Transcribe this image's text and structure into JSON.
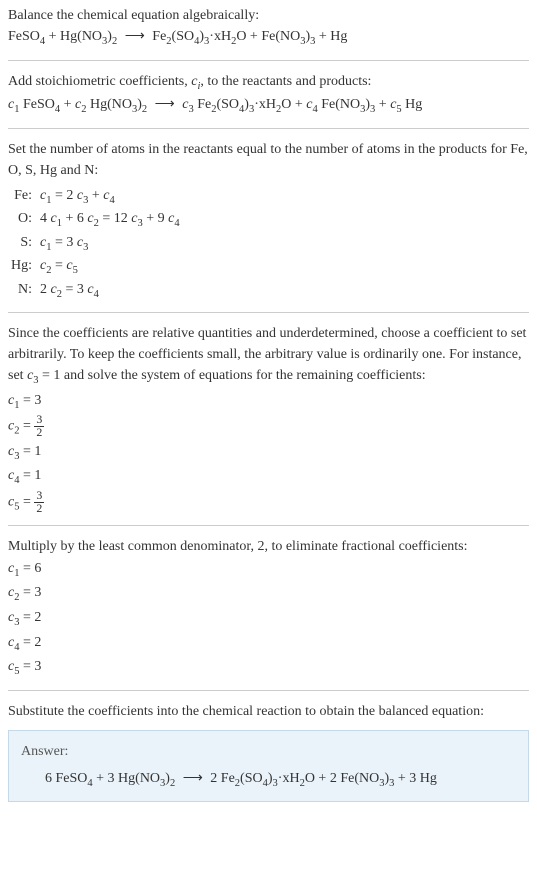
{
  "intro": {
    "line1": "Balance the chemical equation algebraically:",
    "equation": "FeSO₄ + Hg(NO₃)₂  ⟶  Fe₂(SO₄)₃·xH₂O + Fe(NO₃)₃ + Hg"
  },
  "step1": {
    "text": "Add stoichiometric coefficients, cᵢ, to the reactants and products:",
    "equation": "c₁ FeSO₄ + c₂ Hg(NO₃)₂  ⟶  c₃ Fe₂(SO₄)₃·xH₂O + c₄ Fe(NO₃)₃ + c₅ Hg"
  },
  "step2": {
    "text": "Set the number of atoms in the reactants equal to the number of atoms in the products for Fe, O, S, Hg and N:",
    "rows": [
      {
        "label": "Fe:",
        "eq": "c₁ = 2 c₃ + c₄"
      },
      {
        "label": "O:",
        "eq": "4 c₁ + 6 c₂ = 12 c₃ + 9 c₄"
      },
      {
        "label": "S:",
        "eq": "c₁ = 3 c₃"
      },
      {
        "label": "Hg:",
        "eq": "c₂ = c₅"
      },
      {
        "label": "N:",
        "eq": "2 c₂ = 3 c₄"
      }
    ]
  },
  "step3": {
    "text": "Since the coefficients are relative quantities and underdetermined, choose a coefficient to set arbitrarily. To keep the coefficients small, the arbitrary value is ordinarily one. For instance, set c₃ = 1 and solve the system of equations for the remaining coefficients:",
    "coefs": [
      {
        "lhs": "c₁",
        "rhs": "3",
        "frac": null
      },
      {
        "lhs": "c₂",
        "rhs": null,
        "frac": {
          "num": "3",
          "den": "2"
        }
      },
      {
        "lhs": "c₃",
        "rhs": "1",
        "frac": null
      },
      {
        "lhs": "c₄",
        "rhs": "1",
        "frac": null
      },
      {
        "lhs": "c₅",
        "rhs": null,
        "frac": {
          "num": "3",
          "den": "2"
        }
      }
    ]
  },
  "step4": {
    "text": "Multiply by the least common denominator, 2, to eliminate fractional coefficients:",
    "coefs": [
      {
        "lhs": "c₁",
        "rhs": "6"
      },
      {
        "lhs": "c₂",
        "rhs": "3"
      },
      {
        "lhs": "c₃",
        "rhs": "2"
      },
      {
        "lhs": "c₄",
        "rhs": "2"
      },
      {
        "lhs": "c₅",
        "rhs": "3"
      }
    ]
  },
  "step5": {
    "text": "Substitute the coefficients into the chemical reaction to obtain the balanced equation:"
  },
  "answer": {
    "label": "Answer:",
    "equation": "6 FeSO₄ + 3 Hg(NO₃)₂  ⟶  2 Fe₂(SO₄)₃·xH₂O + 2 Fe(NO₃)₃ + 3 Hg"
  }
}
